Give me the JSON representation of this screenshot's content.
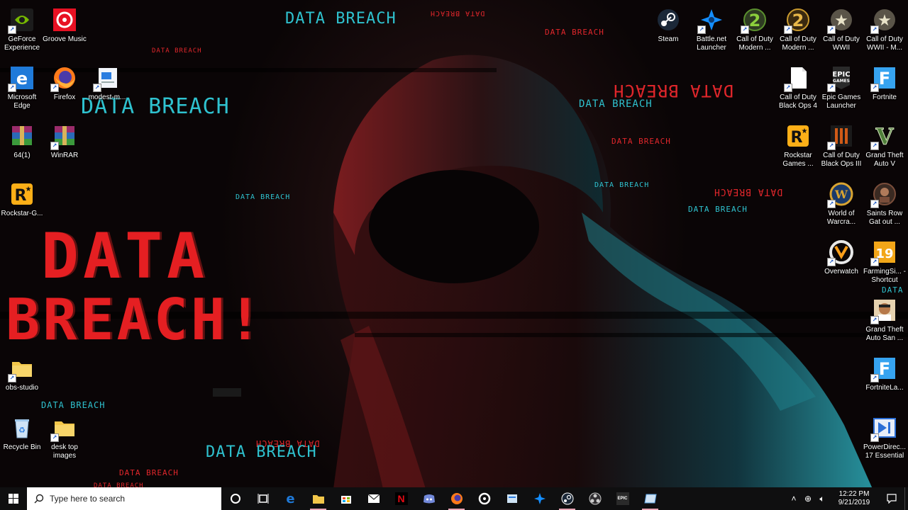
{
  "wallpaper": {
    "big_line1": "DATA",
    "big_line2": "BREACH!",
    "repeated_text": "DATA BREACH",
    "colors": {
      "red": "#e0262b",
      "cyan": "#2fc2cf"
    }
  },
  "desktop_left": [
    {
      "label": "GeForce Experience",
      "icon": "geforce-icon",
      "color": "#76b900"
    },
    {
      "label": "Groove Music",
      "icon": "groove-icon",
      "color": "#e81123"
    },
    {
      "label": "Microsoft Edge",
      "icon": "edge-icon",
      "color": "#1f7ad9"
    },
    {
      "label": "Firefox",
      "icon": "firefox-icon",
      "color": "#ff7a1a"
    },
    {
      "label": "modest-m...",
      "icon": "document-icon",
      "color": "#2b7de0"
    },
    {
      "label": "64(1)",
      "icon": "winrar-archive-icon",
      "color": "#9b2c6b"
    },
    {
      "label": "WinRAR",
      "icon": "winrar-icon",
      "color": "#9b2c6b"
    },
    {
      "label": "Rockstar-G...",
      "icon": "rockstar-icon",
      "color": "#fcaf17"
    },
    {
      "label": "obs-studio",
      "icon": "folder-icon",
      "color": "#f3c74a"
    },
    {
      "label": "Recycle Bin",
      "icon": "recycle-bin-icon",
      "color": "#9fc7ea"
    },
    {
      "label": "desk top images",
      "icon": "folder-icon",
      "color": "#f3c74a"
    }
  ],
  "desktop_right": [
    {
      "label": "Steam",
      "icon": "steam-icon",
      "color": "#1b2838"
    },
    {
      "label": "Battle.net Launcher",
      "icon": "battlenet-icon",
      "color": "#148eff"
    },
    {
      "label": "Call of Duty Modern ...",
      "icon": "cod-mw2-icon",
      "color": "#5a8f2e"
    },
    {
      "label": "Call of Duty Modern ...",
      "icon": "cod-mw2-gold-icon",
      "color": "#c99a2e"
    },
    {
      "label": "Call of Duty WWII",
      "icon": "cod-wwii-icon",
      "color": "#bdb59a"
    },
    {
      "label": "Call of Duty WWII - M...",
      "icon": "cod-wwii-icon",
      "color": "#bdb59a"
    },
    {
      "label": "Call of Duty Black Ops 4",
      "icon": "document-icon",
      "color": "#ffffff"
    },
    {
      "label": "Epic Games Launcher",
      "icon": "epic-games-icon",
      "color": "#2a2a2a"
    },
    {
      "label": "Fortnite",
      "icon": "fortnite-icon",
      "color": "#36a3f0"
    },
    {
      "label": "Rockstar Games ...",
      "icon": "rockstar-icon",
      "color": "#fcaf17"
    },
    {
      "label": "Call of Duty Black Ops III",
      "icon": "cod-bo3-icon",
      "color": "#d05a17"
    },
    {
      "label": "Grand Theft Auto V",
      "icon": "gta-v-icon",
      "color": "#4f7f3a"
    },
    {
      "label": "World of Warcra...",
      "icon": "wow-icon",
      "color": "#d9a431"
    },
    {
      "label": "Saints Row Gat out ...",
      "icon": "saints-row-icon",
      "color": "#7a4d3a"
    },
    {
      "label": "Overwatch",
      "icon": "overwatch-icon",
      "color": "#f99e1a"
    },
    {
      "label": "FarmingSi... - Shortcut",
      "icon": "farming-sim-icon",
      "color": "#f2a618"
    },
    {
      "label": "Grand Theft Auto San ...",
      "icon": "gta-sa-icon",
      "color": "#b7794a"
    },
    {
      "label": "FortniteLa...",
      "icon": "fortnite-icon",
      "color": "#36a3f0"
    },
    {
      "label": "PowerDirec... 17 Essential",
      "icon": "powerdirector-icon",
      "color": "#2c6fd6"
    }
  ],
  "taskbar": {
    "search_placeholder": "Type here to search",
    "apps": [
      {
        "name": "cortana",
        "icon": "cortana-icon"
      },
      {
        "name": "task-view",
        "icon": "task-view-icon"
      },
      {
        "name": "edge",
        "icon": "edge-icon"
      },
      {
        "name": "file-explorer",
        "icon": "file-explorer-icon"
      },
      {
        "name": "store",
        "icon": "store-icon"
      },
      {
        "name": "mail",
        "icon": "mail-icon"
      },
      {
        "name": "netflix",
        "icon": "netflix-icon"
      },
      {
        "name": "discord",
        "icon": "discord-icon"
      },
      {
        "name": "firefox",
        "icon": "firefox-icon"
      },
      {
        "name": "groove",
        "icon": "groove-icon"
      },
      {
        "name": "notepad",
        "icon": "notepad-icon"
      },
      {
        "name": "battlenet",
        "icon": "battlenet-icon"
      },
      {
        "name": "steam",
        "icon": "steam-icon"
      },
      {
        "name": "obs",
        "icon": "obs-icon"
      },
      {
        "name": "epic-games",
        "icon": "epic-games-icon"
      },
      {
        "name": "snip",
        "icon": "snip-icon"
      }
    ],
    "clock_time": "12:22 PM",
    "clock_date": "9/21/2019"
  }
}
